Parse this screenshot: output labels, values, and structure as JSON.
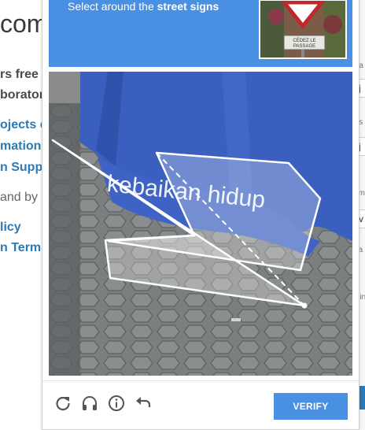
{
  "background_page": {
    "title_fragment": "com",
    "lines": [
      "rs free",
      "borator",
      "ojects c",
      "mation",
      "n Suppo",
      "and by",
      "licy",
      "n Terms"
    ]
  },
  "right_edge": {
    "labels": [
      "Na",
      "Us",
      "Em",
      "Pa",
      "Min"
    ],
    "field_values": [
      "j",
      "j",
      "v"
    ]
  },
  "captcha": {
    "instruction_prefix": "Select around the ",
    "instruction_bold": "street signs",
    "thumbnail_sign_text": "CEDEZ LE PASSAGE",
    "image_text": "kebaikan hidup",
    "toolbar": {
      "refresh_icon": "refresh-icon",
      "audio_icon": "headphones-icon",
      "info_icon": "info-icon",
      "undo_icon": "undo-icon"
    },
    "verify_label": "VERIFY",
    "colors": {
      "accent": "#4a90e2",
      "umbrella": "#3b5fbf"
    }
  }
}
